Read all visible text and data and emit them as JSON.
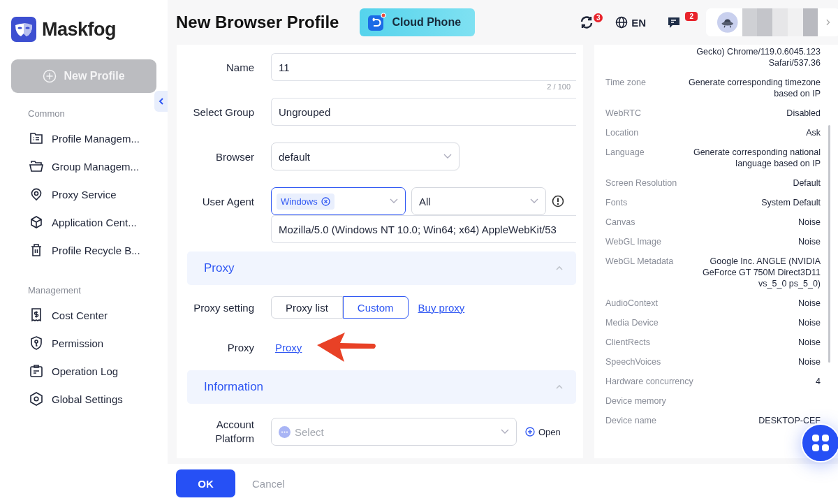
{
  "app": {
    "name": "Maskfog",
    "new_profile": {
      "label": "New Profile",
      "disabled": true
    }
  },
  "sidebar": {
    "sections": [
      {
        "title": "Common",
        "items": [
          {
            "label": "Profile Managem..."
          },
          {
            "label": "Group Managem..."
          },
          {
            "label": "Proxy Service"
          },
          {
            "label": "Application Cent..."
          },
          {
            "label": "Profile Recycle B..."
          }
        ]
      },
      {
        "title": "Management",
        "items": [
          {
            "label": "Cost Center"
          },
          {
            "label": "Permission"
          },
          {
            "label": "Operation Log"
          },
          {
            "label": "Global Settings"
          }
        ]
      }
    ]
  },
  "header": {
    "title": "New Browser Profile",
    "banner": "Cloud Phone",
    "sync_badge": "3",
    "language": "EN",
    "messages_badge": "2"
  },
  "form": {
    "name": {
      "label": "Name",
      "value": "11",
      "counter": "2 / 100"
    },
    "group": {
      "label": "Select Group",
      "value": "Ungrouped"
    },
    "browser": {
      "label": "Browser",
      "value": "default"
    },
    "user_agent": {
      "label": "User Agent",
      "tag": "Windows",
      "filter": "All",
      "string": "Mozilla/5.0 (Windows NT 10.0; Win64; x64) AppleWebKit/53"
    },
    "proxy_section": {
      "title": "Proxy",
      "expanded": true
    },
    "proxy_setting": {
      "label": "Proxy setting",
      "options": [
        {
          "label": "Proxy list",
          "selected": false
        },
        {
          "label": "Custom",
          "selected": true
        }
      ],
      "link": "Buy proxy"
    },
    "proxy": {
      "label": "Proxy",
      "link": "Proxy"
    },
    "information_section": {
      "title": "Information",
      "expanded": true
    },
    "account_platform": {
      "label": "Account Platform",
      "placeholder": "Select",
      "action": "Open"
    }
  },
  "summary": [
    {
      "value": "Gecko) Chrome/119.0.6045.123 Safari/537.36"
    },
    {
      "label": "Time zone",
      "value": "Generate corresponding timezone based on IP"
    },
    {
      "label": "WebRTC",
      "value": "Disabled"
    },
    {
      "label": "Location",
      "value": "Ask"
    },
    {
      "label": "Language",
      "value": "Generate corresponding national language based on IP"
    },
    {
      "label": "Screen Resolution",
      "value": "Default"
    },
    {
      "label": "Fonts",
      "value": "System Default"
    },
    {
      "label": "Canvas",
      "value": "Noise"
    },
    {
      "label": "WebGL Image",
      "value": "Noise"
    },
    {
      "label": "WebGL Metadata",
      "value": "Google Inc. ANGLE (NVIDIA GeForce GT 750M Direct3D11 vs_5_0 ps_5_0)"
    },
    {
      "label": "AudioContext",
      "value": "Noise"
    },
    {
      "label": "Media Device",
      "value": "Noise"
    },
    {
      "label": "ClientRects",
      "value": "Noise"
    },
    {
      "label": "SpeechVoices",
      "value": "Noise"
    },
    {
      "label": "Hardware concurrency",
      "value": "4"
    },
    {
      "label": "Device memory"
    },
    {
      "label": "Device name",
      "value": "DESKTOP-CEF"
    }
  ],
  "footer": {
    "ok": "OK",
    "cancel": "Cancel"
  }
}
